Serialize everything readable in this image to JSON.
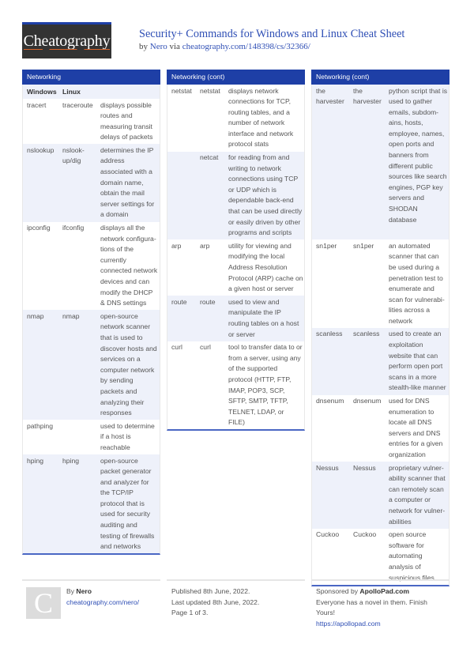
{
  "header": {
    "logo_text": "Cheatography",
    "title": "Security+ Commands for Windows and Linux Cheat Sheet",
    "by_prefix": "by ",
    "author": "Nero",
    "via": " via ",
    "url": "cheatography.com/148398/cs/32366/"
  },
  "colors": {
    "accent": "#1e3fa6",
    "link": "#2f4fb5",
    "row_alt": "#eef1fa"
  },
  "columns": [
    {
      "title": "Networking",
      "table_header": [
        "Windows",
        "Linux",
        ""
      ],
      "rows": [
        {
          "windows": "tracert",
          "linux": "traceroute",
          "desc": "displays possible\nroutes and\nmeasuring transit\ndelays of packets"
        },
        {
          "windows": "nslookup",
          "linux": "nslook-\nup/dig",
          "desc": "determines the IP\naddress\nassociated with a\ndomain name,\nobtain the mail\nserver settings for\na domain"
        },
        {
          "windows": "ipconfig",
          "linux": "ifconfig",
          "desc": "displays all the\nnetwork configura-\ntions of the\ncurrently\nconnected network\ndevices and can\nmodify the DHCP\n& DNS settings"
        },
        {
          "windows": "nmap",
          "linux": "nmap",
          "desc": "open-source\nnetwork scanner\nthat is used to\ndiscover hosts and\nservices on a\ncomputer network\nby sending\npackets and\nanalyzing their\nresponses"
        },
        {
          "windows": "pathping",
          "linux": "",
          "desc": "used to determine\nif a host is\nreachable"
        },
        {
          "windows": "hping",
          "linux": "hping",
          "desc": "open-source\npacket generator\nand analyzer for\nthe TCP/IP\nprotocol that is\nused for security\nauditing and\ntesting of firewalls\nand networks"
        }
      ]
    },
    {
      "title": "Networking (cont)",
      "rows": [
        {
          "windows": "netstat",
          "linux": "netstat",
          "desc": "displays network\nconnections for TCP,\nrouting tables, and a\nnumber of network\ninterface and network\nprotocol stats"
        },
        {
          "windows": "",
          "linux": "netcat",
          "desc": "for reading from and\nwriting to network\nconnections using TCP\nor UDP which is\ndependable back-end\nthat can be used directly\nor easily driven by other\nprograms and scripts"
        },
        {
          "windows": "arp",
          "linux": "arp",
          "desc": "utility for viewing and\nmodifying the local\nAddress Resolution\nProtocol (ARP) cache on\na given host or server"
        },
        {
          "windows": "route",
          "linux": "route",
          "desc": "used to view and\nmanipulate the IP\nrouting tables on a host\nor server"
        },
        {
          "windows": "curl",
          "linux": "curl",
          "desc": "tool to transfer data to or\nfrom a server, using any\nof the supported\nprotocol (HTTP, FTP,\nIMAP, POP3, SCP,\nSFTP, SMTP, TFTP,\nTELNET, LDAP, or\nFILE)"
        }
      ]
    },
    {
      "title": "Networking (cont)",
      "rows": [
        {
          "windows": "the\nharvester",
          "linux": "the\nharvester",
          "desc": "python script that is\nused to gather\nemails, subdom-\nains, hosts,\nemployee, names,\nopen ports and\nbanners from\ndifferent public\nsources like search\nengines, PGP key\nservers and\nSHODAN\ndatabase"
        },
        {
          "windows": "sn1per",
          "linux": "sn1per",
          "desc": "an automated\nscanner that can\nbe used during a\npenetration test to\nenumerate and\nscan for vulnerabi-\nlities across a\nnetwork"
        },
        {
          "windows": "scanless",
          "linux": "scanless",
          "desc": "used to create an\nexploitation\nwebsite that can\nperform open port\nscans in a more\nstealth-like manner"
        },
        {
          "windows": "dnsenum",
          "linux": "dnsenum",
          "desc": "used for DNS\nenumeration to\nlocate all DNS\nservers and DNS\nentries for a given\norganization"
        },
        {
          "windows": "Nessus",
          "linux": "Nessus",
          "desc": "proprietary vulner-\nability scanner that\ncan remotely scan\na computer or\nnetwork for vulner-\nabilities"
        },
        {
          "windows": "Cuckoo",
          "linux": "Cuckoo",
          "desc": "open source\nsoftware for\nautomating\nanalysis of\nsuspicious files"
        }
      ]
    }
  ],
  "footer": {
    "avatar_letter": "C",
    "by_prefix": "By ",
    "author": "Nero",
    "author_url": "cheatography.com/nero/",
    "published": "Published 8th June, 2022.",
    "updated": "Last updated 8th June, 2022.",
    "page": "Page 1 of 3.",
    "sponsor_prefix": "Sponsored by ",
    "sponsor_name": "ApolloPad.com",
    "sponsor_text_1": "Everyone has a novel in them. Finish",
    "sponsor_text_2": "Yours!",
    "sponsor_url": "https://apollopad.com"
  }
}
